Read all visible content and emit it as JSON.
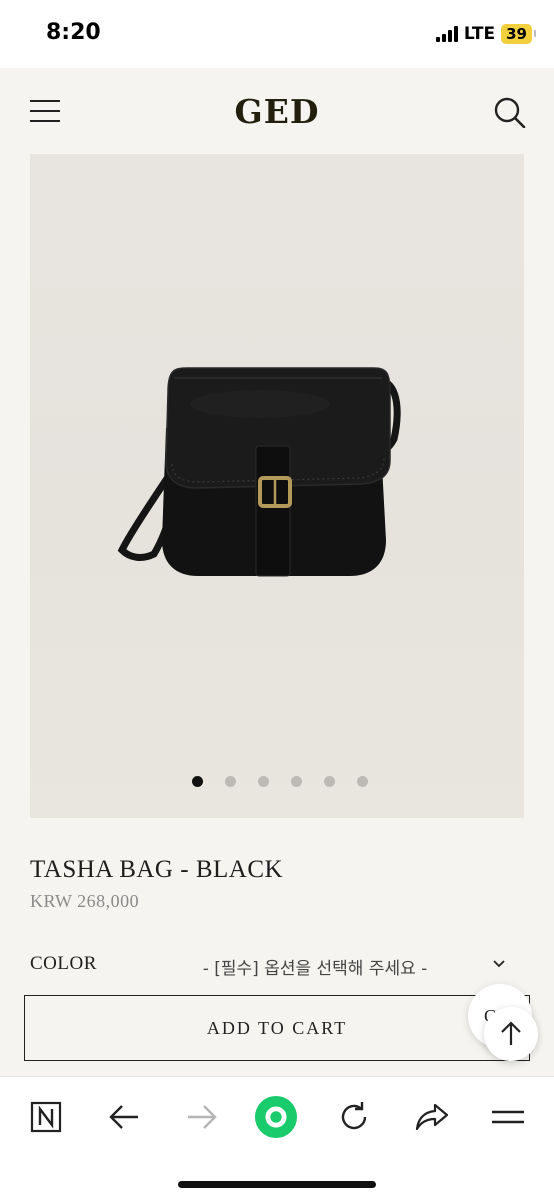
{
  "status_bar": {
    "time": "8:20",
    "network": "LTE",
    "battery": "39"
  },
  "header": {
    "logo": "GED",
    "menu_icon": "hamburger-menu-icon",
    "search_icon": "search-icon"
  },
  "gallery": {
    "image_description": "black leather saddle crossbody bag with brass buckle",
    "slide_count": 6,
    "active_slide": 1
  },
  "product": {
    "title": "TASHA BAG - BLACK",
    "price": "KRW 268,000"
  },
  "options": {
    "color_label": "COLOR",
    "color_select_value": "- [필수] 옵션을 선택해 주세요 -"
  },
  "actions": {
    "add_to_cart_label": "ADD TO CART",
    "chat_label": "C"
  },
  "browser_toolbar": {
    "icons": [
      "naver-n-icon",
      "back-arrow-icon",
      "forward-arrow-icon",
      "home-green-icon",
      "reload-icon",
      "share-icon",
      "menu-icon"
    ]
  },
  "colors": {
    "page_bg": "#f6f4f1",
    "logo": "#231f0e",
    "accent_green": "#19cb6a",
    "battery": "#f2cf3d"
  }
}
